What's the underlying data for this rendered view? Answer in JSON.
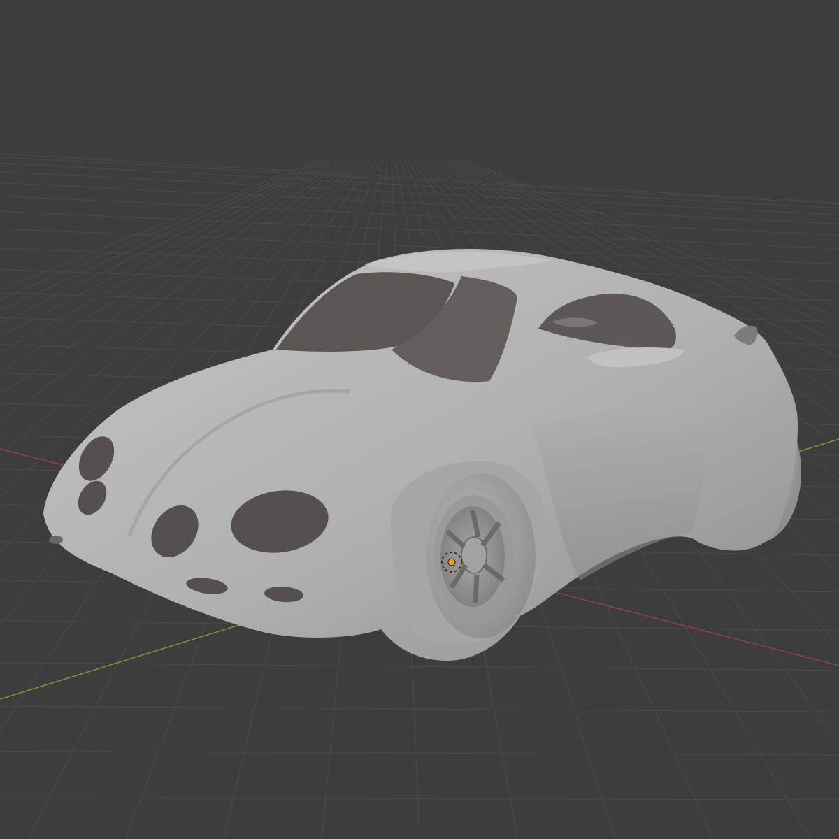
{
  "viewport": {
    "background": "#3d3d3d",
    "grid_color": "#4a4a4a",
    "axis_x_color": "#9a3f40",
    "axis_y_color": "#6f9a3b",
    "origin_marker_color": "#f0a030"
  },
  "model": {
    "name_hint": "car-body",
    "base_color": "#b2b2b2",
    "shadow_color": "#7d7d7d",
    "highlight_color": "#c8c8c8",
    "cabin_color": "#5a5654",
    "hole_color": "#545050"
  }
}
